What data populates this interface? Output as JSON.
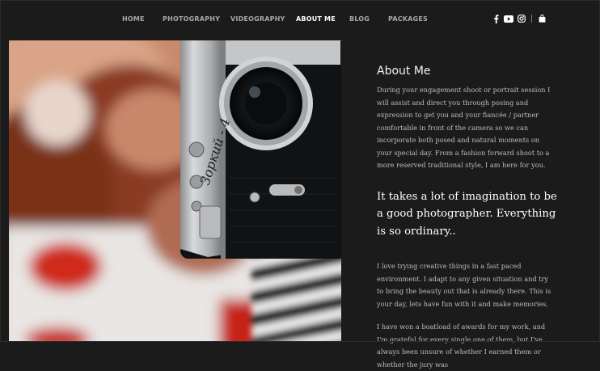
{
  "nav": {
    "items": [
      {
        "label": "HOME",
        "active": false
      },
      {
        "label": "PHOTOGRAPHY",
        "active": false
      },
      {
        "label": "VIDEOGRAPHY",
        "active": false
      },
      {
        "label": "ABOUT ME",
        "active": true
      },
      {
        "label": "BLOG",
        "active": false
      },
      {
        "label": "PACKAGES",
        "active": false
      }
    ]
  },
  "social": {
    "icons": [
      "facebook-icon",
      "youtube-icon",
      "instagram-icon",
      "shopping-bag-icon"
    ]
  },
  "hero": {
    "camera_engraving": "Зоркий - 4"
  },
  "about": {
    "title": "About Me",
    "intro": "During your engagement shoot or portrait session I will assist and direct you through posing and expression to get you and your fiancée / partner comfortable in front of the camera so we can incorporate both posed and natural moments on your special day. From a fashion forward shoot to a more reserved traditional style, I am here for you.",
    "quote": "It takes a lot of imagination to be a good photographer. Everything is so ordinary..",
    "para2": "I love trying creative things in a fast paced environment. I adapt to any given situation and try to bring the beauty out that is already there. This is your day, lets have fun with it and make memories.",
    "para3": "I have won a boatload of awards for my work, and I'm grateful for every single one of them, but I've always been unsure of whether I earned them or whether the jury was"
  },
  "colors": {
    "background": "#1b1b1b",
    "text_muted": "#bdbdbd",
    "nav_inactive": "#a8a8a8",
    "nav_active": "#ffffff"
  }
}
